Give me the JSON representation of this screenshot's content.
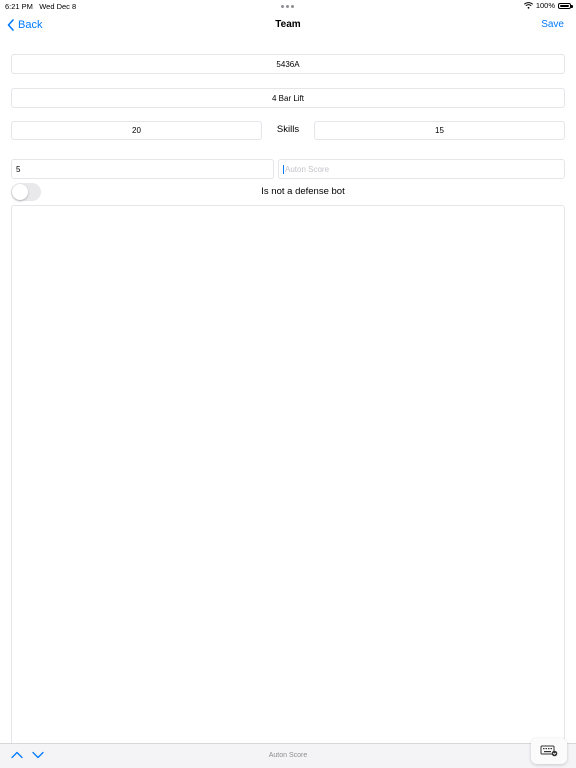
{
  "status_bar": {
    "time": "6:21 PM",
    "date": "Wed Dec 8",
    "battery": "100%"
  },
  "nav": {
    "back_label": "Back",
    "title": "Team",
    "save_label": "Save"
  },
  "form": {
    "team_number": "5436A",
    "robot_type": "4 Bar Lift",
    "driver_score": "20",
    "skills_label": "Skills",
    "programming_score": "15",
    "match_value": "5",
    "auton_placeholder": "Auton Score",
    "defense_label": "Is not a defense bot",
    "defense_toggle_on": false
  },
  "keyboard_toolbar": {
    "field_label": "Auton Score"
  },
  "colors": {
    "accent": "#007aff",
    "field_border": "#e5e5ea",
    "placeholder": "#c4c4c9"
  }
}
